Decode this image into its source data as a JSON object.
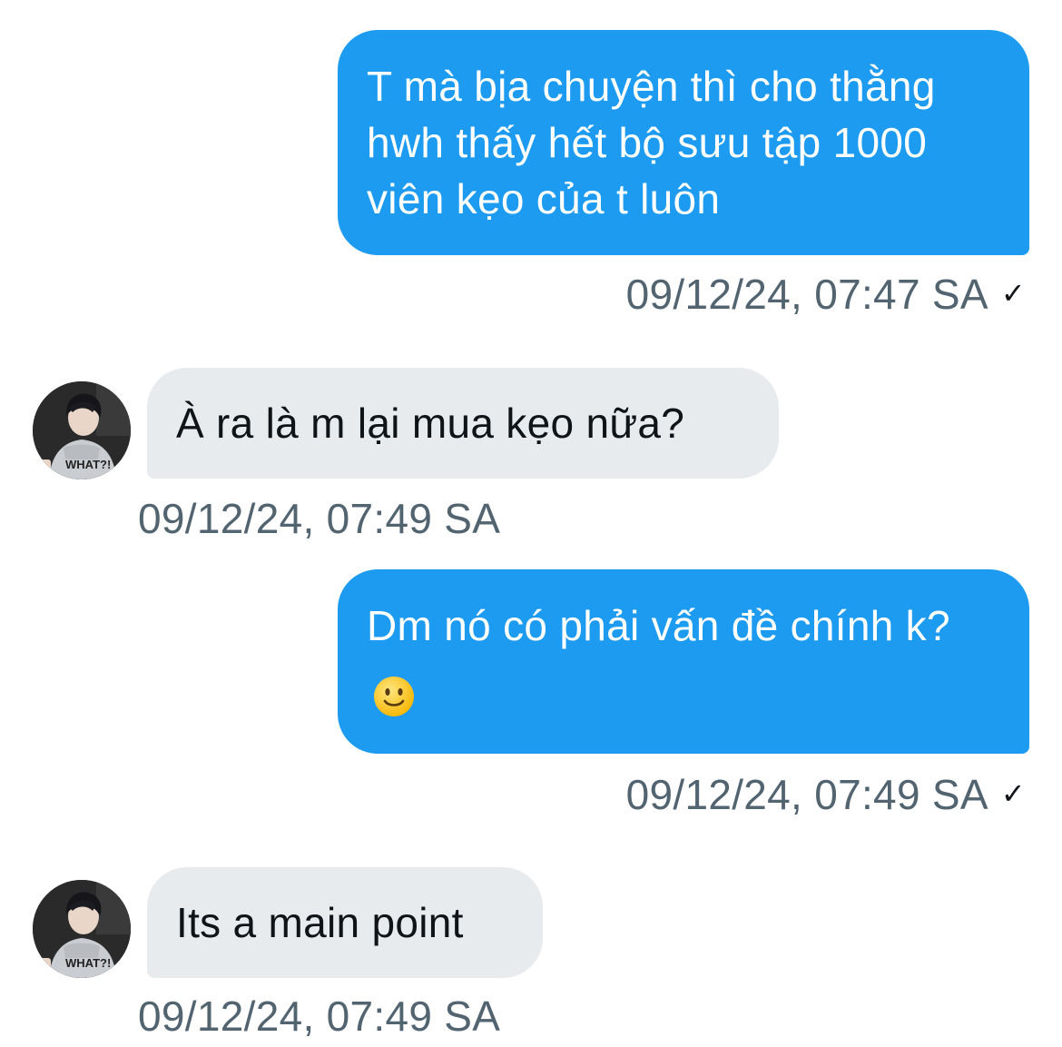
{
  "conversation": {
    "messages": [
      {
        "direction": "sent",
        "text": "T mà bịa chuyện thì cho thằng hwh thấy hết bộ sưu tập 1000 viên kẹo của t luôn",
        "timestamp": "09/12/24, 07:47 SA",
        "status": "✓"
      },
      {
        "direction": "received",
        "text": "À ra là m lại mua kẹo nữa?",
        "timestamp": "09/12/24, 07:49 SA"
      },
      {
        "direction": "sent",
        "text": "Dm nó có phải vấn đề chính k?",
        "emoji": "slightly-smiling-face",
        "timestamp": "09/12/24, 07:49 SA",
        "status": "✓"
      },
      {
        "direction": "received",
        "text": "Its a main point",
        "timestamp": "09/12/24, 07:49 SA"
      }
    ]
  },
  "colors": {
    "sent_bubble": "#1d9bf0",
    "received_bubble": "#e7ebee",
    "timestamp_text": "#536471",
    "background": "#ffffff"
  }
}
